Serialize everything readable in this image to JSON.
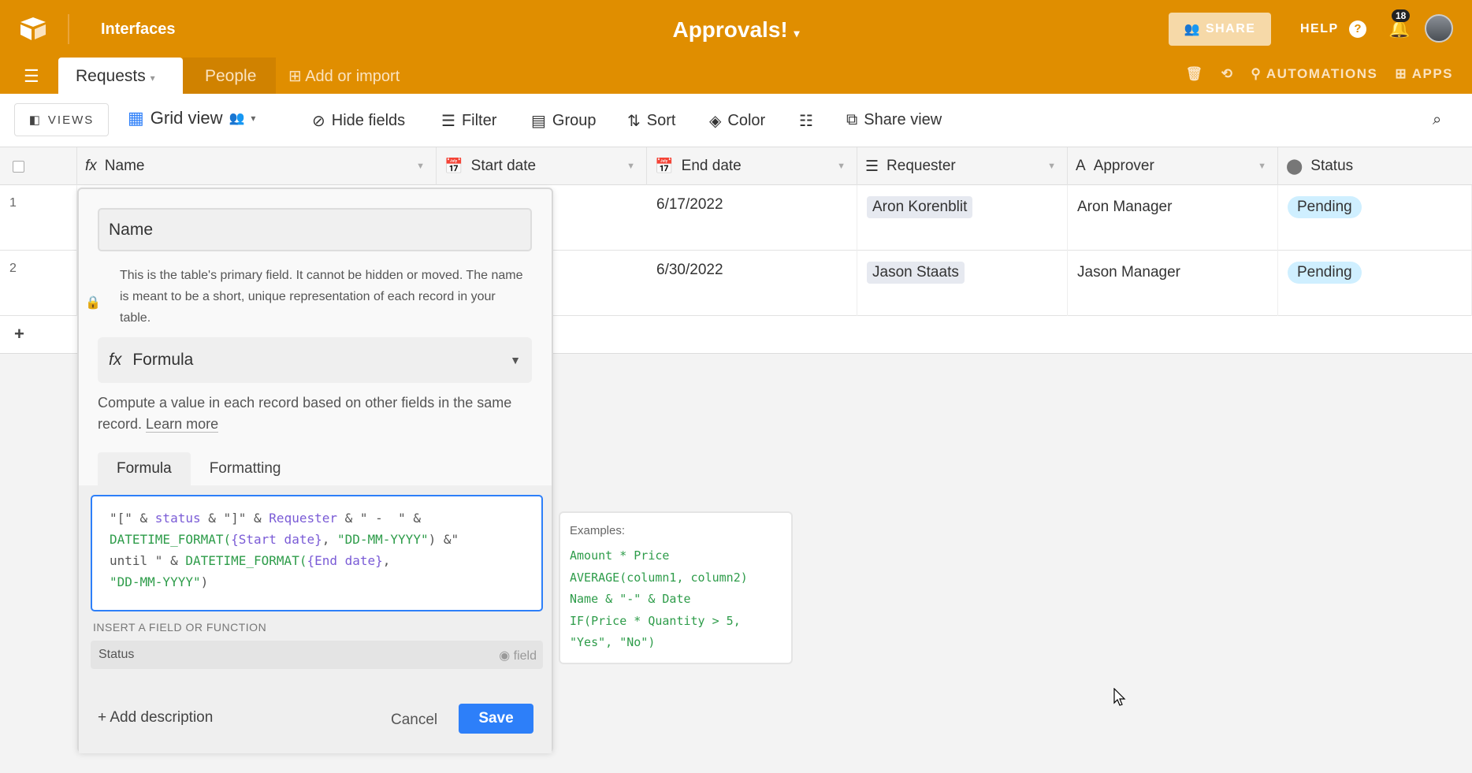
{
  "topbar": {
    "interfaces": "Interfaces",
    "title": "Approvals!",
    "share": "SHARE",
    "help": "HELP",
    "notifications": "18",
    "tabs": [
      {
        "label": "Requests"
      },
      {
        "label": "People"
      }
    ],
    "add_import": "Add or import",
    "automations": "AUTOMATIONS",
    "apps": "APPS"
  },
  "toolbar": {
    "views": "VIEWS",
    "grid_view": "Grid view",
    "hide_fields": "Hide fields",
    "filter": "Filter",
    "group": "Group",
    "sort": "Sort",
    "color": "Color",
    "share_view": "Share view"
  },
  "grid": {
    "columns": [
      "Name",
      "Start date",
      "End date",
      "Requester",
      "Approver",
      "Status"
    ],
    "rows": [
      {
        "num": "1",
        "end": "6/17/2022",
        "requester": "Aron Korenblit",
        "approver": "Aron Manager",
        "status": "Pending"
      },
      {
        "num": "2",
        "end": "6/30/2022",
        "requester": "Jason Staats",
        "approver": "Jason Manager",
        "status": "Pending"
      }
    ],
    "add_row": "+"
  },
  "dialog": {
    "field_name": "Name",
    "primary_info": "This is the table's primary field. It cannot be hidden or moved. The name is meant to be a short, unique representation of each record in your table.",
    "field_type": "Formula",
    "description": "Compute a value in each record based on other fields in the same record.",
    "learn_more": "Learn more",
    "tabs": [
      "Formula",
      "Formatting"
    ],
    "formula": [
      "\"[\" & ",
      "status",
      " & \"]\" & ",
      "Requester",
      " & \" -  \" &",
      "DATETIME_FORMAT(",
      "{Start date}",
      ", ",
      "\"DD-MM-YYYY\"",
      ") &\"",
      "until \" & ",
      "DATETIME_FORMAT(",
      "{End date}",
      ",",
      "\"DD-MM-YYYY\"",
      ")"
    ],
    "insert_label": "INSERT A FIELD OR FUNCTION",
    "insert_item": "Status",
    "insert_kind": "field",
    "add_description": "+ Add description",
    "cancel": "Cancel",
    "save": "Save"
  },
  "examples": {
    "title": "Examples:",
    "lines": [
      "Amount * Price",
      "AVERAGE(column1, column2)",
      "Name & \"-\" & Date",
      "IF(Price * Quantity > 5,",
      "\"Yes\", \"No\")"
    ]
  },
  "colors": {
    "brand": "#e08e00",
    "primary": "#2d7ff9",
    "status_pill": "#cfefff"
  }
}
